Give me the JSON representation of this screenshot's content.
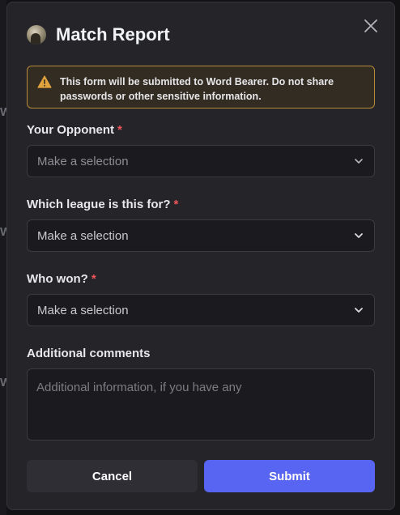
{
  "modal": {
    "title": "Match Report",
    "warning": {
      "prefix": "This form will be submitted to ",
      "target": "Word Bearer",
      "suffix": ". Do not share passwords or other sensitive information."
    },
    "fields": [
      {
        "label": "Your Opponent",
        "required_mark": "*",
        "placeholder": "Make a selection"
      },
      {
        "label": "Which league is this for?",
        "required_mark": "*",
        "placeholder": "Make a selection"
      },
      {
        "label": "Who won?",
        "required_mark": "*",
        "placeholder": "Make a selection"
      }
    ],
    "comments": {
      "label": "Additional comments",
      "placeholder": "Additional information, if you have any"
    },
    "buttons": {
      "cancel": "Cancel",
      "submit": "Submit"
    }
  },
  "icons": {
    "close": "close-icon",
    "warning": "warning-triangle-icon",
    "chevron": "chevron-down-icon"
  },
  "colors": {
    "accent": "#5865f2",
    "warning_border": "#b58a3a",
    "required": "#f2555a"
  }
}
